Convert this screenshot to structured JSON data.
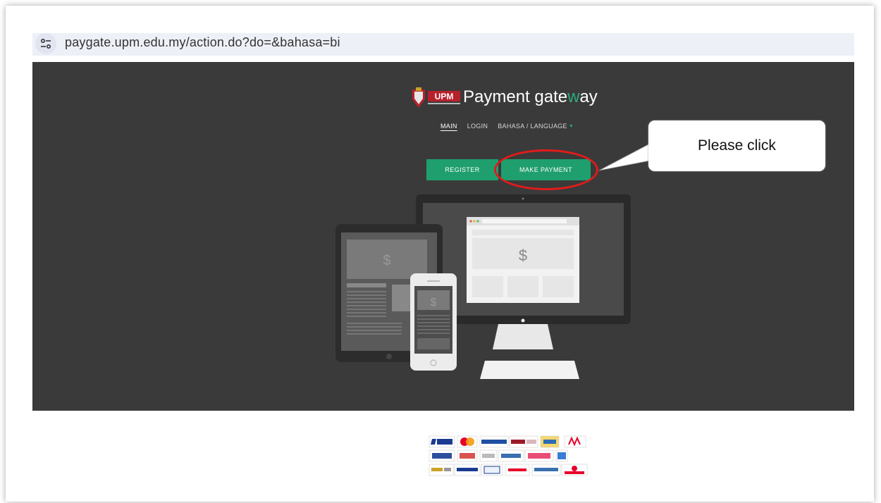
{
  "browser": {
    "url": "paygate.upm.edu.my/action.do?do=&bahasa=bi",
    "site_icon": "tune-icon"
  },
  "brand": {
    "logo_text": "UPM",
    "title_prefix": "Payment gate",
    "title_accent": "w",
    "title_suffix": "ay"
  },
  "nav": {
    "items": [
      "MAIN",
      "LOGIN",
      "BAHASA / LANGUAGE"
    ],
    "active": "MAIN"
  },
  "buttons": {
    "register": "REGISTER",
    "make_payment": "MAKE PAYMENT"
  },
  "annotation": {
    "callout_text": "Please click"
  },
  "illustration": {
    "currency_symbol": "$"
  },
  "colors": {
    "hero_bg": "#3a3a3a",
    "accent_green": "#1f9e6e",
    "annotation_red": "#e11b1b"
  }
}
